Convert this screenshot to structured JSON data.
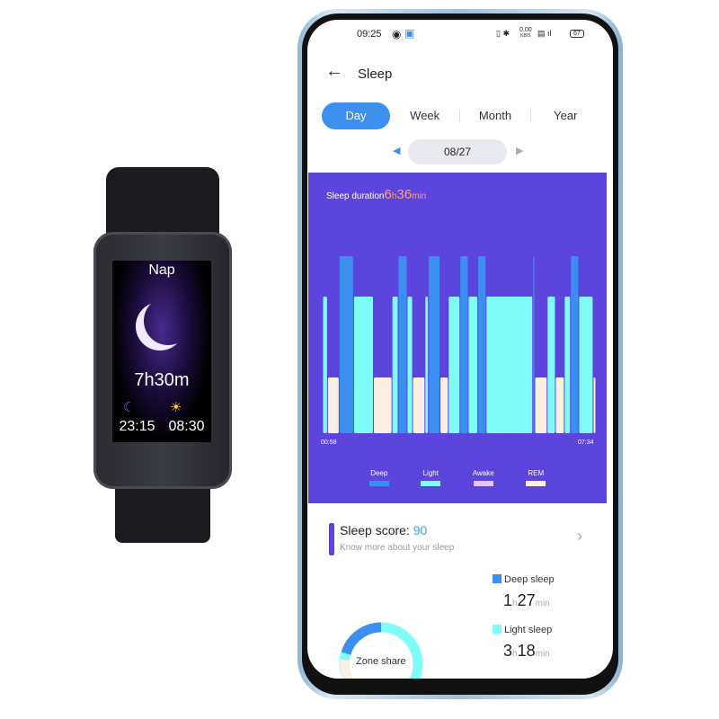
{
  "watch": {
    "title": "Nap",
    "duration": "7h30m",
    "bedtime": "23:15",
    "wake_time": "08:30",
    "icons": [
      "moon-icon",
      "sleep-moon-icon",
      "sun-icon"
    ]
  },
  "status_bar": {
    "time": "09:25",
    "speed": "0.00",
    "speed_unit": "KB/S",
    "battery": "67"
  },
  "header": {
    "title": "Sleep",
    "back_icon": "arrow-left-icon"
  },
  "tabs": [
    {
      "label": "Day",
      "active": true
    },
    {
      "label": "Week"
    },
    {
      "label": "Month"
    },
    {
      "label": "Year"
    }
  ],
  "date_nav": {
    "date": "08/27"
  },
  "sleep_card": {
    "label": "Sleep duration",
    "hours": "6",
    "h_unit": "h",
    "minutes": "36",
    "min_unit": "min",
    "background": "#5b45dc"
  },
  "chart_data": {
    "type": "timeline",
    "x_start": "00:58",
    "x_end": "07:34",
    "tick_labels": [
      "00:58",
      "07:34"
    ],
    "stage_order": [
      "REM",
      "Light",
      "Deep"
    ],
    "legend": [
      {
        "name": "Deep",
        "color": "#3a8ff0"
      },
      {
        "name": "Light",
        "color": "#7ffcf8"
      },
      {
        "name": "Awake",
        "color": "#e6c4f5"
      },
      {
        "name": "REM",
        "color": "#fbeee3"
      }
    ],
    "segments_minutes": [
      [
        "Light",
        7
      ],
      [
        "REM",
        17
      ],
      [
        "Deep",
        21
      ],
      [
        "Light",
        29
      ],
      [
        "REM",
        27
      ],
      [
        "Light",
        9
      ],
      [
        "Deep",
        13
      ],
      [
        "Light",
        8
      ],
      [
        "REM",
        18
      ],
      [
        "Light",
        5
      ],
      [
        "Deep",
        17
      ],
      [
        "REM",
        12
      ],
      [
        "Light",
        17
      ],
      [
        "Deep",
        12
      ],
      [
        "Light",
        14
      ],
      [
        "Deep",
        12
      ],
      [
        "Light",
        68
      ],
      [
        "Deep",
        3
      ],
      [
        "REM",
        18
      ],
      [
        "Light",
        12
      ],
      [
        "REM",
        13
      ],
      [
        "Light",
        9
      ],
      [
        "Deep",
        12
      ],
      [
        "Light",
        21
      ],
      [
        "REM",
        4
      ]
    ]
  },
  "score": {
    "label": "Sleep score: ",
    "value": "90",
    "subtitle": "Know more about your sleep"
  },
  "stats": [
    {
      "label": "Deep sleep",
      "h": "1",
      "m": "27",
      "color": "#3a8ff0"
    },
    {
      "label": "Light sleep",
      "h": "3",
      "m": "18",
      "color": "#7ffcf8"
    }
  ],
  "units": {
    "h": "h",
    "min": "min"
  },
  "donut": {
    "label": "Zone share"
  }
}
